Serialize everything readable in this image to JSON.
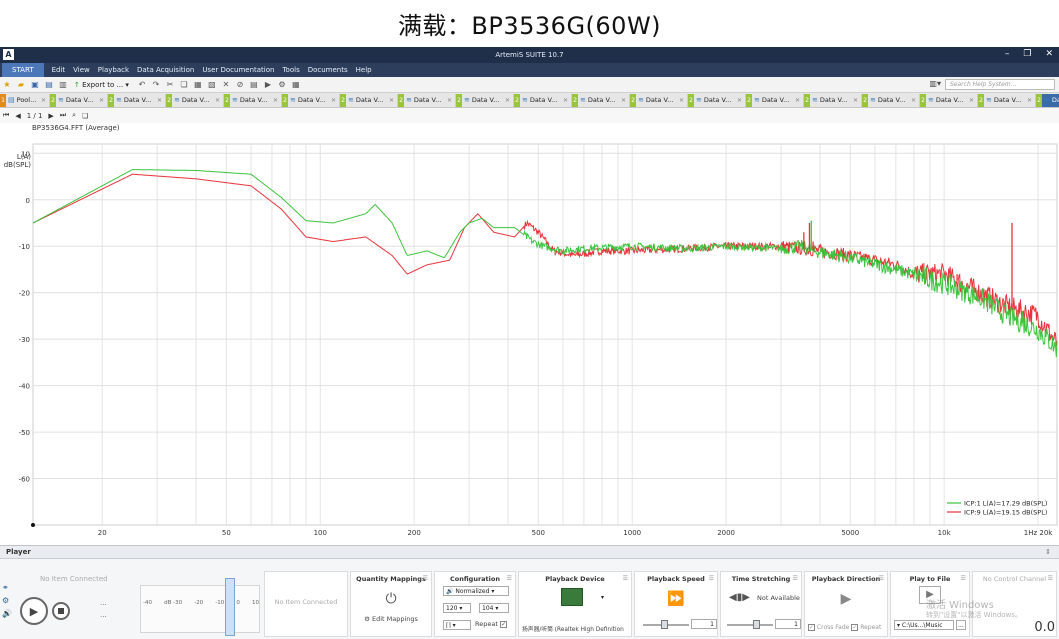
{
  "banner": {
    "title": "满载：BP3536G(60W)"
  },
  "window": {
    "title": "ArtemiS SUITE 10.7",
    "app_icon": "A"
  },
  "menu": {
    "start": "START",
    "items": [
      "Edit",
      "View",
      "Playback",
      "Data Acquisition",
      "User Documentation",
      "Tools",
      "Documents",
      "Help"
    ]
  },
  "toolbar": {
    "export_label": "Export to ...",
    "search_placeholder": "Search Help System..."
  },
  "tabs": {
    "first": {
      "badge": "1",
      "label": "Pool..."
    },
    "data_label": "Data V...",
    "badge": "2",
    "count": 18
  },
  "nav": {
    "page": "1 / 1"
  },
  "chart_title": "BP3536G4.FFT (Average)",
  "chart_data": {
    "type": "line",
    "xscale": "log",
    "xlim": [
      12,
      23000
    ],
    "ylim": [
      -70,
      12
    ],
    "ylabel": "L(A)\ndB(SPL)",
    "xticks": [
      {
        "v": 20,
        "label": "20"
      },
      {
        "v": 50,
        "label": "50"
      },
      {
        "v": 100,
        "label": "100"
      },
      {
        "v": 200,
        "label": "200"
      },
      {
        "v": 500,
        "label": "500"
      },
      {
        "v": 1000,
        "label": "1000"
      },
      {
        "v": 2000,
        "label": "2000"
      },
      {
        "v": 5000,
        "label": "5000"
      },
      {
        "v": 10000,
        "label": "10k"
      },
      {
        "v": 20000,
        "label": "1Hz 20k"
      }
    ],
    "yticks": [
      10,
      0,
      -10,
      -20,
      -30,
      -40,
      -50,
      -60
    ],
    "grid": true,
    "legend_position": "bottom-right",
    "series": [
      {
        "name": "ICP:1 L(A)=17.29 dB(SPL)",
        "color": "#3cc43c",
        "points": [
          [
            12,
            -5
          ],
          [
            25,
            6.5
          ],
          [
            40,
            6.3
          ],
          [
            60,
            5.5
          ],
          [
            75,
            0.5
          ],
          [
            90,
            -4.5
          ],
          [
            110,
            -5
          ],
          [
            140,
            -3
          ],
          [
            150,
            -1
          ],
          [
            170,
            -5
          ],
          [
            190,
            -12
          ],
          [
            220,
            -11
          ],
          [
            250,
            -12.5
          ],
          [
            280,
            -7
          ],
          [
            300,
            -5
          ],
          [
            330,
            -4
          ],
          [
            360,
            -6
          ],
          [
            420,
            -6
          ],
          [
            480,
            -9
          ],
          [
            520,
            -10
          ],
          [
            600,
            -11
          ],
          [
            700,
            -10.5
          ],
          [
            1000,
            -10
          ],
          [
            1500,
            -10.5
          ],
          [
            2000,
            -10
          ],
          [
            3000,
            -10.5
          ],
          [
            3500,
            -10
          ],
          [
            3800,
            -11
          ],
          [
            5000,
            -12.5
          ],
          [
            7000,
            -15
          ],
          [
            10000,
            -18
          ],
          [
            13000,
            -21
          ],
          [
            16000,
            -25
          ],
          [
            20000,
            -28
          ],
          [
            23000,
            -32
          ]
        ]
      },
      {
        "name": "ICP:9 L(A)=19.15 dB(SPL)",
        "color": "#e8323c",
        "points": [
          [
            12,
            -5
          ],
          [
            25,
            5.5
          ],
          [
            40,
            4.5
          ],
          [
            60,
            3
          ],
          [
            75,
            -2
          ],
          [
            90,
            -8
          ],
          [
            110,
            -9
          ],
          [
            140,
            -8
          ],
          [
            170,
            -12
          ],
          [
            190,
            -16
          ],
          [
            220,
            -14
          ],
          [
            260,
            -13
          ],
          [
            290,
            -6
          ],
          [
            320,
            -3
          ],
          [
            360,
            -7
          ],
          [
            420,
            -8
          ],
          [
            460,
            -5
          ],
          [
            500,
            -7
          ],
          [
            560,
            -11
          ],
          [
            650,
            -12
          ],
          [
            800,
            -11
          ],
          [
            1000,
            -11
          ],
          [
            1500,
            -10.5
          ],
          [
            2000,
            -10
          ],
          [
            3000,
            -10
          ],
          [
            4000,
            -11
          ],
          [
            5000,
            -12
          ],
          [
            7000,
            -14
          ],
          [
            8000,
            -16
          ],
          [
            10000,
            -16
          ],
          [
            13000,
            -20
          ],
          [
            16000,
            -23
          ],
          [
            20000,
            -25
          ],
          [
            23000,
            -31
          ]
        ]
      }
    ],
    "spikes": [
      {
        "series": 1,
        "x": 3700,
        "y": -5
      },
      {
        "series": 1,
        "x": 3800,
        "y": -9
      },
      {
        "series": 1,
        "x": 3550,
        "y": -7
      },
      {
        "series": 1,
        "x": 16500,
        "y": -5
      },
      {
        "series": 1,
        "x": 17300,
        "y": -24
      },
      {
        "series": 1,
        "x": 9000,
        "y": -15
      },
      {
        "series": 1,
        "x": 11000,
        "y": -16
      },
      {
        "series": 0,
        "x": 3750,
        "y": -4.5
      },
      {
        "series": 0,
        "x": 17800,
        "y": -24
      }
    ]
  },
  "player": {
    "title": "Player",
    "no_item": "No Item Connected",
    "no_item2": "No Item Connected",
    "dots": [
      "...",
      "..."
    ],
    "vu_scale": [
      "-40",
      "dB -30",
      "-20",
      "-10",
      "0",
      "10"
    ],
    "panels": {
      "qm_title": "Quantity Mappings",
      "qm_action": "Edit Mappings",
      "config_title": "Configuration",
      "config_mode": "Normalized",
      "config_v1": "120",
      "config_v2": "104",
      "config_repeat": "Repeat",
      "device_title": "Playback Device",
      "device_label": "扬声器/听筒 (Realtek High Definition",
      "speed_title": "Playback Speed",
      "speed_value": "1",
      "stretch_title": "Time Stretching",
      "stretch_status": "Not Available",
      "stretch_value": "1",
      "direction_title": "Playback Direction",
      "direction_cross": "Cross Fade",
      "direction_repeat": "Repeat",
      "file_title": "Play to File",
      "file_path": "C:\\Us...\\Music",
      "file_browse": "...",
      "control_title": "No Control Channel"
    },
    "watermark": "激活 Windows",
    "watermark2": "转到\"设置\"以激活 Windows。",
    "counter": "0.0"
  }
}
